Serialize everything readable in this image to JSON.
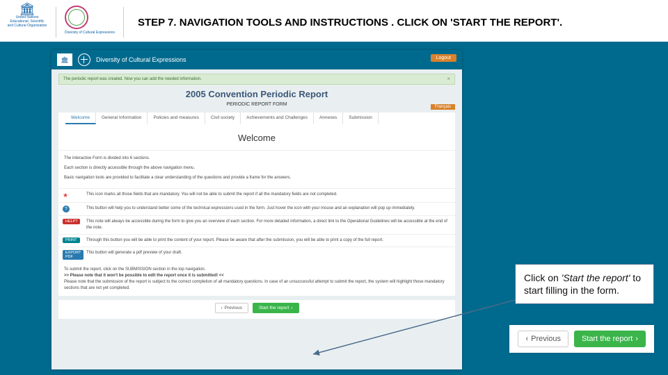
{
  "header": {
    "unesco_caption": "United Nations\nEducational, Scientific and\nCultural Organization",
    "globe_caption": "Diversity of\nCultural Expressions",
    "slide_title": "STEP 7. NAVIGATION TOOLS AND INSTRUCTIONS . CLICK ON 'START THE REPORT'."
  },
  "screenshot": {
    "brand": "Diversity of Cultural Expressions",
    "logout": "Logout",
    "greenbar": "The periodic report was created. Now you can add the needed information.",
    "report_title": "2005 Convention Periodic Report",
    "report_sub": "PERIODIC REPORT FORM",
    "tabs": [
      "Welcome",
      "General Information",
      "Policies and measures",
      "Civil society",
      "Achievements and Challenges",
      "Annexes",
      "Submission"
    ],
    "lang_btn": "Français",
    "welcome": "Welcome",
    "intro_lines": [
      "The interactive Form is divided into 6 sections.",
      "Each section is directly accessible through the above navigation menu.",
      "Basic navigation tools are provided to facilitate a clear understanding of the questions and provide a frame for the answers."
    ],
    "tools": [
      {
        "icon": "star",
        "text": "This icon marks all those fields that are mandatory. You will not be able to submit the report if all the mandatory fields are not completed."
      },
      {
        "icon": "qmark",
        "text": "This button will help you to understand better some of the technical expressions used in the form. Just hover the icon with your mouse and an explanation will pop up immediately."
      },
      {
        "icon": "help",
        "label": "HELP?",
        "text": "This note will always be accessible during the form to give you an overview of each section. For more detailed information, a direct link to the Operational Guidelines will be accessible at the end of the note."
      },
      {
        "icon": "print",
        "label": "PRINT",
        "text": "Through this button you will be able to print the content of your report. Please be aware that after the submission, you will be able to print a copy of the full report."
      },
      {
        "icon": "export",
        "label": "EXPORT PDF",
        "text": "This button will generate a pdf preview of your draft."
      }
    ],
    "submit_lines": [
      "To submit the report, click on the SUBMISSION section in the top navigation.",
      ">> Please note that it won't be possible to edit the report once it is submitted! <<",
      "Please note that the submission of the report is subject to the correct completion of all mandatory questions. In case of an unsuccessful attempt to submit the report, the system will highlight those mandatory sections that are not yet completed."
    ],
    "prev_btn": "Previous",
    "start_btn": "Start the report"
  },
  "callout": {
    "line1": "Click on ",
    "em": "'Start the report'",
    "line2": " to start filling in the form."
  },
  "zoom": {
    "prev": "Previous",
    "start": "Start the report"
  }
}
